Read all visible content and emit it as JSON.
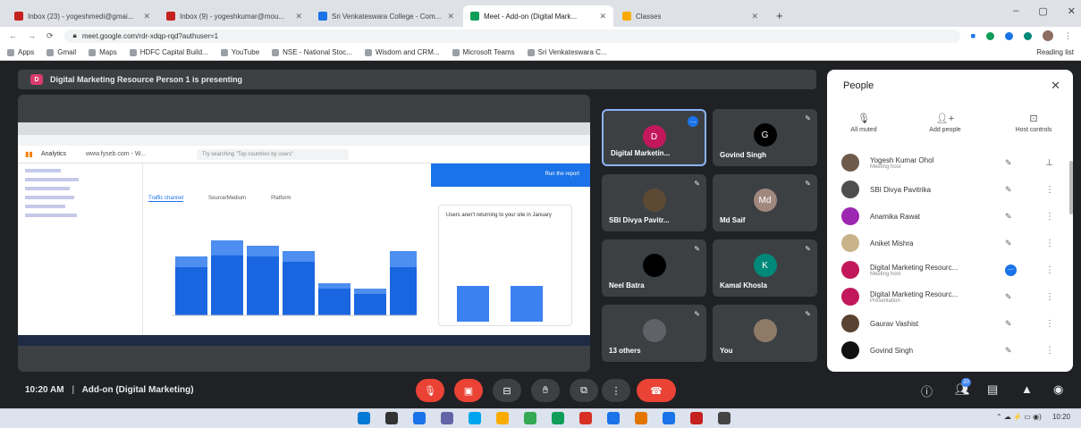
{
  "browser": {
    "tabs": [
      {
        "label": "Inbox (23) - yogeshmedi@gmai...",
        "color": "#c5221f",
        "active": false
      },
      {
        "label": "Inbox (9) - yogeshkumar@mou...",
        "color": "#c5221f",
        "active": false
      },
      {
        "label": "Sri Venkateswara College - Com...",
        "color": "#1a73e8",
        "active": false
      },
      {
        "label": "Meet - Add-on (Digital Mark...",
        "color": "#0f9d58",
        "active": true
      },
      {
        "label": "Classes",
        "color": "#f9ab00",
        "active": false
      }
    ],
    "new_tab": "+",
    "url": "meet.google.com/rdr-xdqp-rqd?authuser=1",
    "bookmarks": [
      "Apps",
      "Gmail",
      "Maps",
      "HDFC Capital Build...",
      "YouTube",
      "NSE - National Stoc...",
      "Wisdom and CRM...",
      "Microsoft Teams",
      "Sri Venkateswara C..."
    ],
    "reading_list": "Reading list"
  },
  "meet": {
    "banner": "Digital Marketing Resource Person 1 is presenting",
    "banner_badge": "D",
    "participants": [
      {
        "name": "Digital Marketin...",
        "initial": "D",
        "color": "#c2185b"
      },
      {
        "name": "Govind Singh",
        "initial": "G",
        "color": "#000000"
      },
      {
        "name": "SBI Divya Pavitr...",
        "initial": "",
        "color": "#5d4a35"
      },
      {
        "name": "Md Saif",
        "initial": "Md",
        "color": "#a1887f"
      },
      {
        "name": "Neel Batra",
        "initial": "",
        "color": "#000000"
      },
      {
        "name": "Kamal Khosla",
        "initial": "K",
        "color": "#00897b"
      },
      {
        "name": "13 others",
        "initial": "",
        "color": "#5f6368"
      },
      {
        "name": "You",
        "initial": "",
        "color": "#8d7b68"
      }
    ],
    "shared_screen": {
      "app": "Analytics",
      "site": "www.fyseb.com - W...",
      "search_placeholder": "Try searching \"Top countries by users\"",
      "button": "Run the report",
      "tabs": [
        "Traffic channel",
        "Source/Medium",
        "Platform"
      ],
      "insight_title": "Users aren't returning to your site in January",
      "chart_type": "bar",
      "bars": [
        {
          "total": 0.55,
          "top": 0.1
        },
        {
          "total": 0.7,
          "top": 0.14
        },
        {
          "total": 0.65,
          "top": 0.1
        },
        {
          "total": 0.6,
          "top": 0.1
        },
        {
          "total": 0.3,
          "top": 0.05
        },
        {
          "total": 0.25,
          "top": 0.05
        },
        {
          "total": 0.6,
          "top": 0.15
        }
      ],
      "side_bars": [
        0.5,
        0.5
      ]
    },
    "people_panel": {
      "title": "People",
      "actions": [
        "All muted",
        "Add people",
        "Host controls"
      ],
      "list": [
        {
          "name": "Yogesh Kumar Ohol",
          "sub": "Meeting host",
          "color": "#6d5a4a"
        },
        {
          "name": "SBI Divya Pavitrika",
          "sub": "",
          "color": "#4e4e4e"
        },
        {
          "name": "Anamika Rawat",
          "sub": "",
          "color": "#9c27b0"
        },
        {
          "name": "Aniket Mishra",
          "sub": "",
          "color": "#c9b38a"
        },
        {
          "name": "Digital Marketing Resourc...",
          "sub": "Meeting host",
          "color": "#c2185b"
        },
        {
          "name": "Digital Marketing Resourc...",
          "sub": "Presentation",
          "color": "#c2185b"
        },
        {
          "name": "Gaurav Vashist",
          "sub": "",
          "color": "#5a4232"
        },
        {
          "name": "Govind Singh",
          "sub": "",
          "color": "#111111"
        }
      ]
    },
    "time": "10:20 AM",
    "separator": "|",
    "meeting_name": "Add-on (Digital Marketing)",
    "participant_count": "20"
  },
  "taskbar": {
    "tray_time": "10:20"
  }
}
